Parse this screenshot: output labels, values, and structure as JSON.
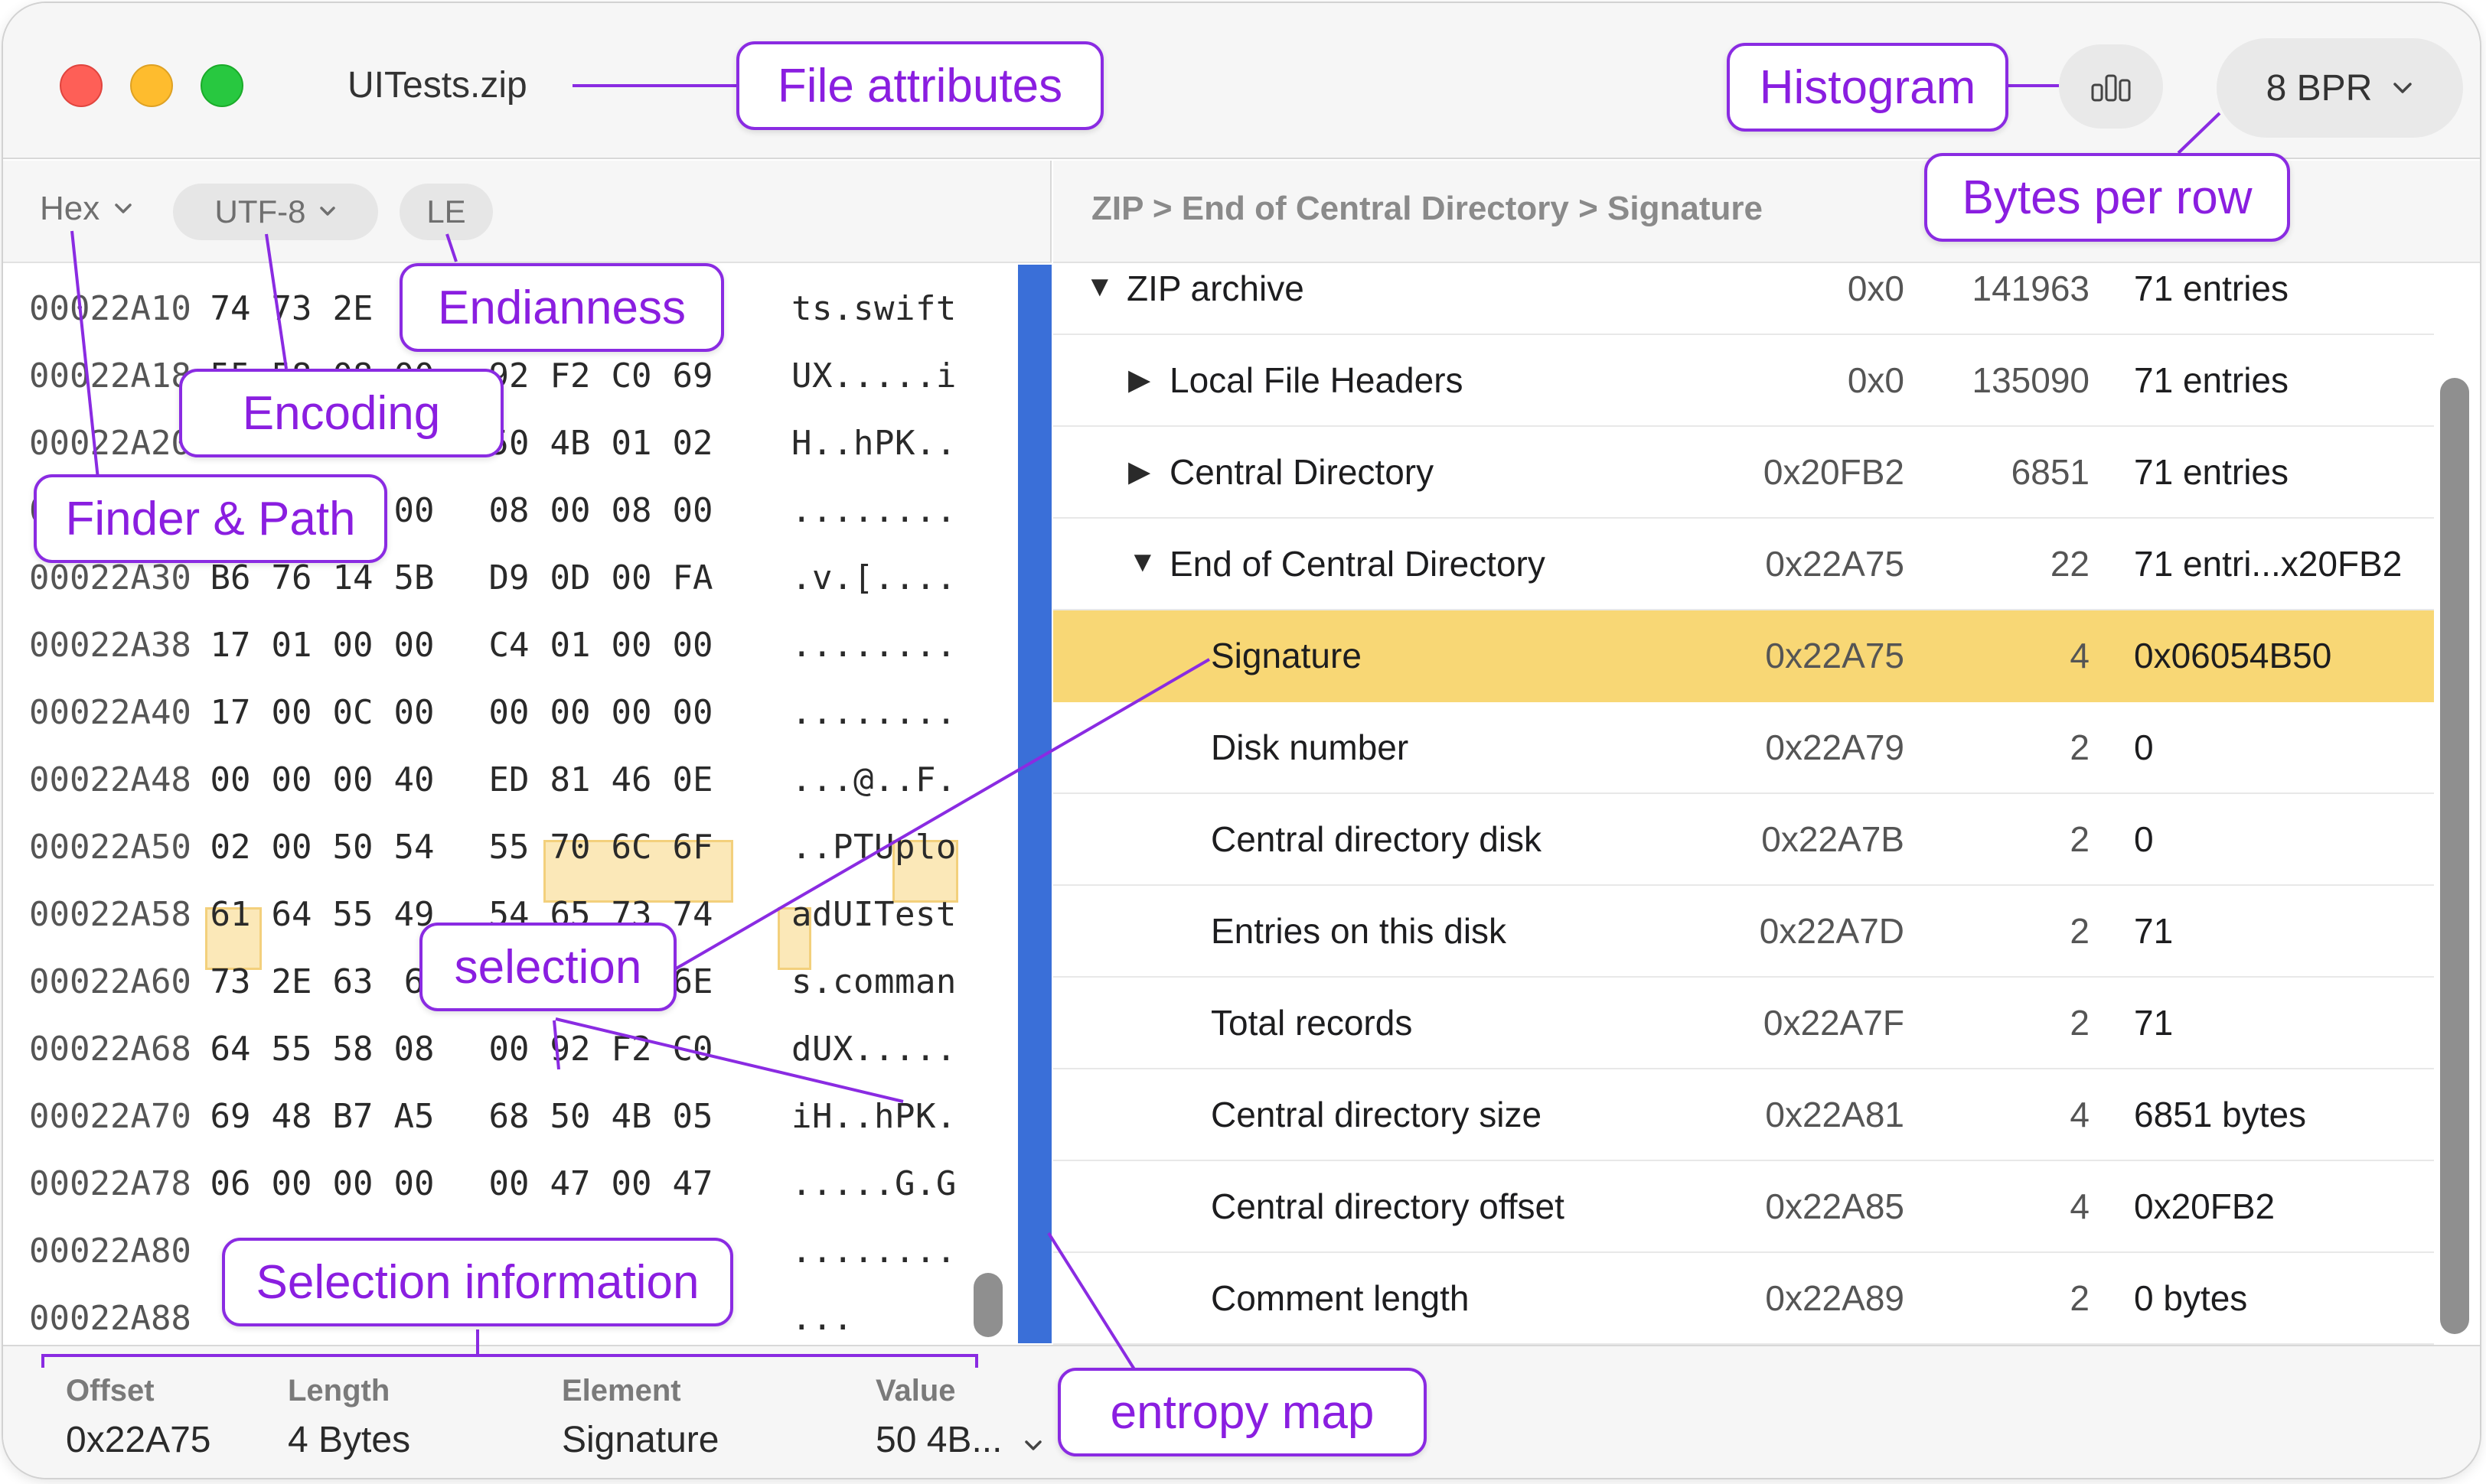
{
  "window": {
    "title": "UITests.zip",
    "bpr_label": "8 BPR"
  },
  "left_toolbar": {
    "mode": "Hex",
    "encoding": "UTF-8",
    "endianness": "LE"
  },
  "hex_rows": [
    {
      "offset": "00022A10",
      "bytes": [
        "74",
        "73",
        "2E",
        "",
        "",
        "",
        "",
        ""
      ],
      "ascii": "ts.swift"
    },
    {
      "offset": "00022A18",
      "bytes": [
        "55",
        "58",
        "08",
        "00",
        "92",
        "F2",
        "C0",
        "69"
      ],
      "ascii": "UX.....i"
    },
    {
      "offset": "00022A20",
      "bytes": [
        "",
        "",
        "",
        "",
        "50",
        "4B",
        "01",
        "02"
      ],
      "ascii": "H..hPK.."
    },
    {
      "offset": "00022A28",
      "bytes": [
        "",
        "",
        "",
        "00",
        "08",
        "00",
        "08",
        "00"
      ],
      "ascii": "........"
    },
    {
      "offset": "00022A30",
      "bytes": [
        "B6",
        "76",
        "14",
        "5B",
        "D9",
        "0D",
        "00",
        "FA"
      ],
      "ascii": ".v.[...."
    },
    {
      "offset": "00022A38",
      "bytes": [
        "17",
        "01",
        "00",
        "00",
        "C4",
        "01",
        "00",
        "00"
      ],
      "ascii": "........"
    },
    {
      "offset": "00022A40",
      "bytes": [
        "17",
        "00",
        "0C",
        "00",
        "00",
        "00",
        "00",
        "00"
      ],
      "ascii": "........"
    },
    {
      "offset": "00022A48",
      "bytes": [
        "00",
        "00",
        "00",
        "40",
        "ED",
        "81",
        "46",
        "0E"
      ],
      "ascii": "...@..F."
    },
    {
      "offset": "00022A50",
      "bytes": [
        "02",
        "00",
        "50",
        "54",
        "55",
        "70",
        "6C",
        "6F"
      ],
      "ascii": "..PTUplo"
    },
    {
      "offset": "00022A58",
      "bytes": [
        "61",
        "64",
        "55",
        "49",
        "54",
        "65",
        "73",
        "74"
      ],
      "ascii": "adUITest"
    },
    {
      "offset": "00022A60",
      "bytes": [
        "73",
        "2E",
        "63",
        "6",
        "",
        "",
        "",
        "6E"
      ],
      "ascii": "s.comman"
    },
    {
      "offset": "00022A68",
      "bytes": [
        "64",
        "55",
        "58",
        "08",
        "00",
        "92",
        "F2",
        "C0"
      ],
      "ascii": "dUX....."
    },
    {
      "offset": "00022A70",
      "bytes": [
        "69",
        "48",
        "B7",
        "A5",
        "68",
        "50",
        "4B",
        "05"
      ],
      "ascii": "iH..hPK."
    },
    {
      "offset": "00022A78",
      "bytes": [
        "06",
        "00",
        "00",
        "00",
        "00",
        "47",
        "00",
        "47"
      ],
      "ascii": ".....G.G"
    },
    {
      "offset": "00022A80",
      "bytes": [
        "",
        "",
        "",
        "",
        "",
        "",
        "",
        ""
      ],
      "ascii": "........"
    },
    {
      "offset": "00022A88",
      "bytes": [
        "",
        "",
        "",
        "",
        "",
        "",
        "",
        ""
      ],
      "ascii": "..."
    }
  ],
  "breadcrumb": "ZIP > End of Central Directory > Signature",
  "tree_rows": [
    {
      "name": "ZIP archive",
      "triangle": "▼",
      "offset": "0x0",
      "length": "141963",
      "value": "71 entries"
    },
    {
      "name": "Local File Headers",
      "triangle": "▶",
      "offset": "0x0",
      "length": "135090",
      "value": "71 entries"
    },
    {
      "name": "Central Directory",
      "triangle": "▶",
      "offset": "0x20FB2",
      "length": "6851",
      "value": "71 entries"
    },
    {
      "name": "End of Central Directory",
      "triangle": "▼",
      "offset": "0x22A75",
      "length": "22",
      "value": "71 entri...x20FB2"
    },
    {
      "name": "Signature",
      "triangle": "",
      "offset": "0x22A75",
      "length": "4",
      "value": "0x06054B50"
    },
    {
      "name": "Disk number",
      "triangle": "",
      "offset": "0x22A79",
      "length": "2",
      "value": "0"
    },
    {
      "name": "Central directory disk",
      "triangle": "",
      "offset": "0x22A7B",
      "length": "2",
      "value": "0"
    },
    {
      "name": "Entries on this disk",
      "triangle": "",
      "offset": "0x22A7D",
      "length": "2",
      "value": "71"
    },
    {
      "name": "Total records",
      "triangle": "",
      "offset": "0x22A7F",
      "length": "2",
      "value": "71"
    },
    {
      "name": "Central directory size",
      "triangle": "",
      "offset": "0x22A81",
      "length": "4",
      "value": "6851 bytes"
    },
    {
      "name": "Central directory offset",
      "triangle": "",
      "offset": "0x22A85",
      "length": "4",
      "value": "0x20FB2"
    },
    {
      "name": "Comment length",
      "triangle": "",
      "offset": "0x22A89",
      "length": "2",
      "value": "0 bytes"
    }
  ],
  "status": {
    "offset_label": "Offset",
    "offset_value": "0x22A75",
    "length_label": "Length",
    "length_value": "4 Bytes",
    "element_label": "Element",
    "element_value": "Signature",
    "value_label": "Value",
    "value_value": "50 4B..."
  },
  "callouts": {
    "file_attributes": "File attributes",
    "histogram": "Histogram",
    "bytes_per_row": "Bytes per row",
    "endianness": "Endianness",
    "encoding": "Encoding",
    "finder_path": "Finder & Path",
    "selection": "selection",
    "selection_information": "Selection information",
    "entropy_map": "entropy map"
  },
  "colors": {
    "callout_purple": "#8a2be2",
    "selection_yellow": "#f8d775",
    "entropy_blue": "#3a6fd8"
  },
  "icons": {
    "histogram": "bar-chart-icon",
    "dropdown": "chevron-down-icon",
    "expand": "disclosure-triangle-icon"
  }
}
